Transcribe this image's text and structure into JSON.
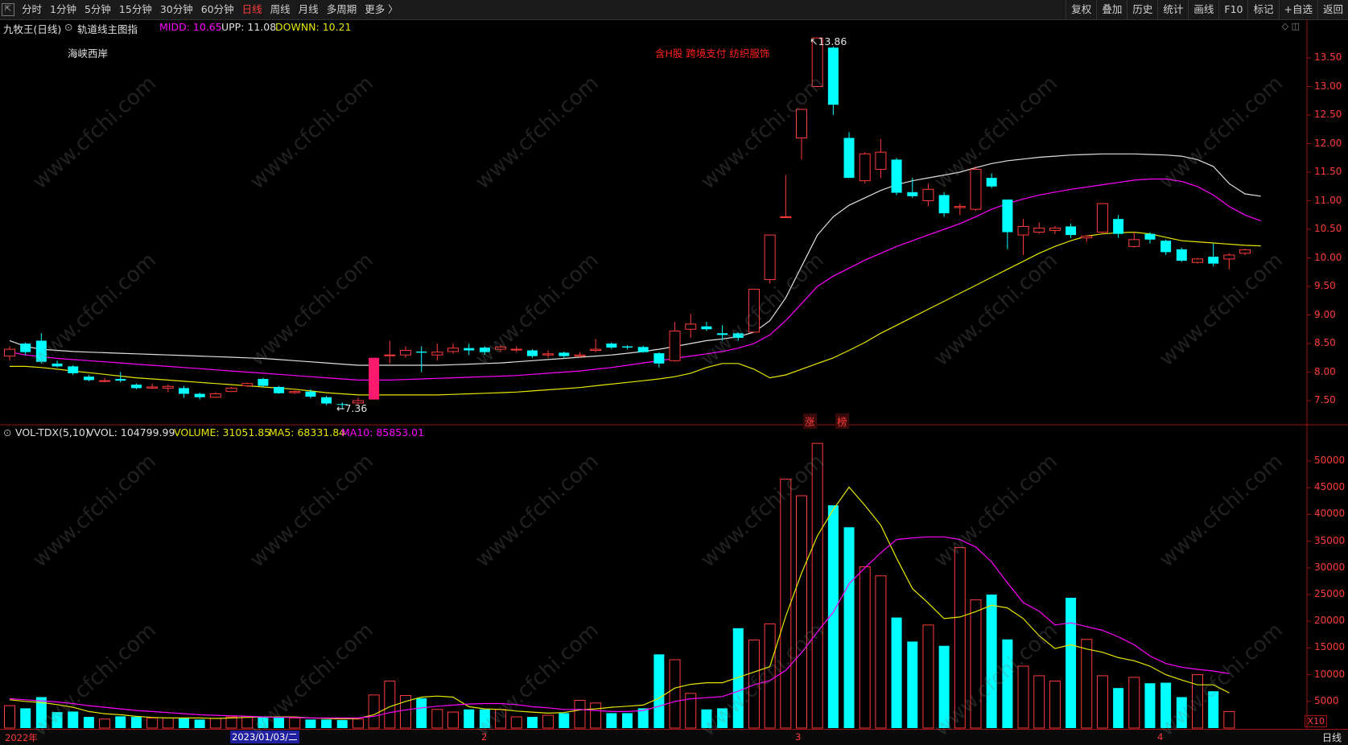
{
  "toolbar": {
    "periods": [
      "分时",
      "1分钟",
      "5分钟",
      "15分钟",
      "30分钟",
      "60分钟",
      "日线",
      "周线",
      "月线",
      "多周期",
      "更多 〉"
    ],
    "active_period": "日线",
    "right_buttons": [
      "复权",
      "叠加",
      "历史",
      "统计",
      "画线",
      "F10",
      "标记",
      "+自选",
      "返回"
    ]
  },
  "main_panel": {
    "stock_title": "九牧王(日线)",
    "indicator_name": "轨道线主图指",
    "midd_label": "MIDD: 10.65",
    "upp_label": "UPP: 11.08",
    "downn_label": "DOWNN: 10.21",
    "region_tag": "海峡西岸",
    "concept_tags": "含H股 跨境支付   纺织服饰",
    "high_marker": "13.86",
    "low_marker": "7.36",
    "event_tag_1": "涨",
    "event_tag_2": "榜",
    "y_axis": [
      "13.50",
      "13.00",
      "12.50",
      "12.00",
      "11.50",
      "11.00",
      "10.50",
      "10.00",
      "9.50",
      "9.00",
      "8.50",
      "8.00",
      "7.50"
    ]
  },
  "volume_panel": {
    "indicator_name": "VOL-TDX(5,10)",
    "vvol_label": "VVOL: 104799.99",
    "volume_label": "VOLUME: 31051.85",
    "ma5_label": "MA5: 68331.84",
    "ma10_label": "MA10: 85853.01",
    "y_axis": [
      "50000",
      "45000",
      "40000",
      "35000",
      "30000",
      "25000",
      "20000",
      "15000",
      "10000",
      "5000"
    ],
    "unit_tag": "X10"
  },
  "bottom_bar": {
    "dates": [
      "2022年",
      "2023/01/03/二",
      "2",
      "3",
      "4"
    ],
    "period_label": "日线"
  },
  "watermark_text": "www.cfchi.com",
  "colors": {
    "up": "#ff3b3b",
    "down": "#00ffff",
    "limit_up": "#ff1a6e",
    "upper_band": "#e0e0e0",
    "mid_band": "#ff00ff",
    "lower_band": "#e6e600",
    "axis": "#a01010"
  },
  "chart_data": {
    "type": "candlestick",
    "candles": [
      {
        "o": 8.28,
        "c": 8.4,
        "h": 8.45,
        "l": 8.2
      },
      {
        "o": 8.5,
        "c": 8.35,
        "h": 8.52,
        "l": 8.3
      },
      {
        "o": 8.55,
        "c": 8.18,
        "h": 8.68,
        "l": 8.15
      },
      {
        "o": 8.15,
        "c": 8.1,
        "h": 8.2,
        "l": 8.08
      },
      {
        "o": 8.1,
        "c": 7.98,
        "h": 8.12,
        "l": 7.95
      },
      {
        "o": 7.92,
        "c": 7.86,
        "h": 7.95,
        "l": 7.84
      },
      {
        "o": 7.85,
        "c": 7.85,
        "h": 7.9,
        "l": 7.82
      },
      {
        "o": 7.88,
        "c": 7.85,
        "h": 8.0,
        "l": 7.82
      },
      {
        "o": 7.78,
        "c": 7.72,
        "h": 7.8,
        "l": 7.7
      },
      {
        "o": 7.72,
        "c": 7.74,
        "h": 7.8,
        "l": 7.7
      },
      {
        "o": 7.72,
        "c": 7.75,
        "h": 7.78,
        "l": 7.65
      },
      {
        "o": 7.72,
        "c": 7.62,
        "h": 7.76,
        "l": 7.55
      },
      {
        "o": 7.62,
        "c": 7.56,
        "h": 7.64,
        "l": 7.52
      },
      {
        "o": 7.56,
        "c": 7.62,
        "h": 7.65,
        "l": 7.55
      },
      {
        "o": 7.66,
        "c": 7.72,
        "h": 7.74,
        "l": 7.65
      },
      {
        "o": 7.76,
        "c": 7.8,
        "h": 7.82,
        "l": 7.74
      },
      {
        "o": 7.88,
        "c": 7.76,
        "h": 7.9,
        "l": 7.74
      },
      {
        "o": 7.74,
        "c": 7.63,
        "h": 7.76,
        "l": 7.62
      },
      {
        "o": 7.64,
        "c": 7.66,
        "h": 7.68,
        "l": 7.62
      },
      {
        "o": 7.66,
        "c": 7.57,
        "h": 7.7,
        "l": 7.54
      },
      {
        "o": 7.56,
        "c": 7.45,
        "h": 7.58,
        "l": 7.42
      },
      {
        "o": 7.44,
        "c": 7.43,
        "h": 7.47,
        "l": 7.36
      },
      {
        "o": 7.46,
        "c": 7.5,
        "h": 7.55,
        "l": 7.43
      },
      {
        "o": 7.52,
        "c": 8.25,
        "h": 8.25,
        "l": 7.52
      },
      {
        "o": 8.3,
        "c": 8.3,
        "h": 8.55,
        "l": 8.15
      },
      {
        "o": 8.3,
        "c": 8.38,
        "h": 8.45,
        "l": 8.25
      },
      {
        "o": 8.36,
        "c": 8.34,
        "h": 8.45,
        "l": 8.0
      },
      {
        "o": 8.3,
        "c": 8.35,
        "h": 8.5,
        "l": 8.2
      },
      {
        "o": 8.36,
        "c": 8.42,
        "h": 8.5,
        "l": 8.32
      },
      {
        "o": 8.42,
        "c": 8.38,
        "h": 8.5,
        "l": 8.3
      },
      {
        "o": 8.43,
        "c": 8.35,
        "h": 8.45,
        "l": 8.3
      },
      {
        "o": 8.4,
        "c": 8.44,
        "h": 8.47,
        "l": 8.35
      },
      {
        "o": 8.4,
        "c": 8.4,
        "h": 8.45,
        "l": 8.35
      },
      {
        "o": 8.38,
        "c": 8.28,
        "h": 8.4,
        "l": 8.25
      },
      {
        "o": 8.3,
        "c": 8.32,
        "h": 8.38,
        "l": 8.25
      },
      {
        "o": 8.34,
        "c": 8.28,
        "h": 8.36,
        "l": 8.25
      },
      {
        "o": 8.28,
        "c": 8.3,
        "h": 8.35,
        "l": 8.25
      },
      {
        "o": 8.38,
        "c": 8.4,
        "h": 8.58,
        "l": 8.35
      },
      {
        "o": 8.5,
        "c": 8.43,
        "h": 8.52,
        "l": 8.4
      },
      {
        "o": 8.45,
        "c": 8.43,
        "h": 8.47,
        "l": 8.4
      },
      {
        "o": 8.44,
        "c": 8.35,
        "h": 8.46,
        "l": 8.34
      },
      {
        "o": 8.33,
        "c": 8.15,
        "h": 8.35,
        "l": 8.08
      },
      {
        "o": 8.2,
        "c": 8.72,
        "h": 8.88,
        "l": 8.18
      },
      {
        "o": 8.75,
        "c": 8.84,
        "h": 9.02,
        "l": 8.6
      },
      {
        "o": 8.8,
        "c": 8.75,
        "h": 8.88,
        "l": 8.72
      },
      {
        "o": 8.68,
        "c": 8.65,
        "h": 8.82,
        "l": 8.55
      },
      {
        "o": 8.68,
        "c": 8.6,
        "h": 8.7,
        "l": 8.55
      },
      {
        "o": 8.7,
        "c": 9.45,
        "h": 9.45,
        "l": 8.7
      },
      {
        "o": 9.62,
        "c": 10.4,
        "h": 10.4,
        "l": 9.55
      },
      {
        "o": 10.72,
        "c": 10.72,
        "h": 11.45,
        "l": 10.72
      },
      {
        "o": 12.1,
        "c": 12.6,
        "h": 12.6,
        "l": 11.72
      },
      {
        "o": 13.0,
        "c": 13.85,
        "h": 13.86,
        "l": 13.0
      },
      {
        "o": 13.68,
        "c": 12.68,
        "h": 13.7,
        "l": 12.5
      },
      {
        "o": 12.1,
        "c": 11.4,
        "h": 12.2,
        "l": 11.4
      },
      {
        "o": 11.35,
        "c": 11.82,
        "h": 11.85,
        "l": 11.3
      },
      {
        "o": 11.55,
        "c": 11.85,
        "h": 12.08,
        "l": 11.4
      },
      {
        "o": 11.72,
        "c": 11.14,
        "h": 11.75,
        "l": 11.1
      },
      {
        "o": 11.15,
        "c": 11.08,
        "h": 11.4,
        "l": 11.05
      },
      {
        "o": 11.0,
        "c": 11.2,
        "h": 11.3,
        "l": 10.9
      },
      {
        "o": 11.1,
        "c": 10.78,
        "h": 11.15,
        "l": 10.72
      },
      {
        "o": 10.88,
        "c": 10.9,
        "h": 10.95,
        "l": 10.75
      },
      {
        "o": 10.85,
        "c": 11.55,
        "h": 11.6,
        "l": 10.82
      },
      {
        "o": 11.4,
        "c": 11.25,
        "h": 11.48,
        "l": 11.22
      },
      {
        "o": 11.02,
        "c": 10.45,
        "h": 11.02,
        "l": 10.15
      },
      {
        "o": 10.4,
        "c": 10.55,
        "h": 10.68,
        "l": 10.05
      },
      {
        "o": 10.45,
        "c": 10.52,
        "h": 10.62,
        "l": 10.42
      },
      {
        "o": 10.48,
        "c": 10.52,
        "h": 10.56,
        "l": 10.42
      },
      {
        "o": 10.55,
        "c": 10.4,
        "h": 10.6,
        "l": 10.35
      },
      {
        "o": 10.35,
        "c": 10.38,
        "h": 10.4,
        "l": 10.28
      },
      {
        "o": 10.45,
        "c": 10.95,
        "h": 10.95,
        "l": 10.42
      },
      {
        "o": 10.68,
        "c": 10.42,
        "h": 10.75,
        "l": 10.35
      },
      {
        "o": 10.2,
        "c": 10.32,
        "h": 10.45,
        "l": 10.18
      },
      {
        "o": 10.42,
        "c": 10.32,
        "h": 10.45,
        "l": 10.25
      },
      {
        "o": 10.3,
        "c": 10.1,
        "h": 10.32,
        "l": 10.05
      },
      {
        "o": 10.15,
        "c": 9.95,
        "h": 10.18,
        "l": 9.93
      },
      {
        "o": 9.92,
        "c": 9.98,
        "h": 10.0,
        "l": 9.9
      },
      {
        "o": 10.02,
        "c": 9.9,
        "h": 10.25,
        "l": 9.85
      },
      {
        "o": 9.98,
        "c": 10.05,
        "h": 10.08,
        "l": 9.8
      },
      {
        "o": 10.08,
        "c": 10.14,
        "h": 10.16,
        "l": 10.05
      }
    ],
    "upper_band": [
      8.55,
      8.45,
      8.4,
      8.38,
      8.36,
      8.35,
      8.34,
      8.33,
      8.32,
      8.31,
      8.3,
      8.29,
      8.28,
      8.27,
      8.26,
      8.25,
      8.24,
      8.22,
      8.2,
      8.18,
      8.16,
      8.14,
      8.12,
      8.12,
      8.12,
      8.12,
      8.12,
      8.12,
      8.13,
      8.14,
      8.15,
      8.16,
      8.18,
      8.2,
      8.22,
      8.24,
      8.26,
      8.28,
      8.3,
      8.33,
      8.36,
      8.4,
      8.45,
      8.5,
      8.55,
      8.58,
      8.62,
      8.7,
      8.9,
      9.3,
      9.85,
      10.4,
      10.72,
      10.92,
      11.05,
      11.18,
      11.28,
      11.35,
      11.4,
      11.45,
      11.5,
      11.58,
      11.65,
      11.7,
      11.73,
      11.76,
      11.78,
      11.8,
      11.81,
      11.82,
      11.82,
      11.82,
      11.81,
      11.8,
      11.78,
      11.72,
      11.6,
      11.3,
      11.12,
      11.08
    ],
    "mid_band": [
      8.35,
      8.3,
      8.27,
      8.24,
      8.22,
      8.2,
      8.18,
      8.16,
      8.14,
      8.12,
      8.1,
      8.08,
      8.06,
      8.04,
      8.02,
      8.0,
      7.98,
      7.96,
      7.94,
      7.92,
      7.9,
      7.88,
      7.86,
      7.86,
      7.86,
      7.87,
      7.88,
      7.89,
      7.9,
      7.91,
      7.92,
      7.93,
      7.94,
      7.96,
      7.98,
      8.0,
      8.02,
      8.05,
      8.08,
      8.12,
      8.16,
      8.2,
      8.24,
      8.28,
      8.32,
      8.36,
      8.42,
      8.5,
      8.65,
      8.9,
      9.2,
      9.5,
      9.68,
      9.82,
      9.96,
      10.08,
      10.2,
      10.3,
      10.4,
      10.5,
      10.6,
      10.72,
      10.85,
      10.95,
      11.03,
      11.1,
      11.15,
      11.2,
      11.24,
      11.28,
      11.32,
      11.36,
      11.38,
      11.38,
      11.34,
      11.25,
      11.1,
      10.9,
      10.75,
      10.65
    ],
    "lower_band": [
      8.1,
      8.1,
      8.08,
      8.05,
      8.02,
      7.99,
      7.96,
      7.93,
      7.9,
      7.88,
      7.86,
      7.84,
      7.82,
      7.8,
      7.78,
      7.76,
      7.74,
      7.72,
      7.7,
      7.67,
      7.64,
      7.62,
      7.6,
      7.6,
      7.6,
      7.6,
      7.6,
      7.6,
      7.61,
      7.62,
      7.63,
      7.64,
      7.65,
      7.67,
      7.69,
      7.71,
      7.73,
      7.76,
      7.79,
      7.82,
      7.85,
      7.88,
      7.92,
      7.98,
      8.08,
      8.15,
      8.15,
      8.05,
      7.9,
      7.95,
      8.05,
      8.15,
      8.25,
      8.38,
      8.52,
      8.68,
      8.82,
      8.96,
      9.1,
      9.24,
      9.38,
      9.52,
      9.66,
      9.8,
      9.94,
      10.08,
      10.2,
      10.3,
      10.38,
      10.42,
      10.44,
      10.45,
      10.42,
      10.36,
      10.3,
      10.28,
      10.26,
      10.24,
      10.22,
      10.21
    ],
    "volume": [
      4200,
      3700,
      5800,
      3000,
      3100,
      2100,
      1700,
      2200,
      2100,
      1900,
      1900,
      1800,
      1600,
      1800,
      2100,
      2200,
      2200,
      2100,
      1900,
      1600,
      1600,
      1500,
      1700,
      6200,
      8800,
      6100,
      5600,
      3500,
      3000,
      3500,
      3500,
      3500,
      2100,
      2100,
      2400,
      2800,
      5200,
      4700,
      2800,
      2800,
      3700,
      13800,
      12800,
      6500,
      3500,
      3700,
      18700,
      16500,
      19500,
      46600,
      43500,
      53300,
      41700,
      37600,
      30200,
      28500,
      20700,
      16200,
      19300,
      15400,
      33800,
      24000,
      25000,
      16600,
      11600,
      9800,
      8800,
      24400,
      16600,
      9800,
      7500,
      9500,
      8400,
      8500,
      5800,
      10000,
      6900,
      3100
    ],
    "vol_ma5": [
      5300,
      5000,
      4800,
      4400,
      3900,
      3100,
      2700,
      2500,
      2200,
      2000,
      1900,
      1900,
      1900,
      1800,
      1900,
      2000,
      2100,
      2100,
      2100,
      1900,
      1800,
      1700,
      1800,
      2500,
      4000,
      5000,
      5800,
      6000,
      5800,
      4000,
      3600,
      3500,
      3200,
      3000,
      2800,
      2900,
      3400,
      3600,
      3900,
      4100,
      4300,
      5600,
      7500,
      8200,
      8500,
      8500,
      9500,
      10500,
      11500,
      20900,
      29000,
      36000,
      40900,
      45100,
      41700,
      38000,
      31800,
      26100,
      23400,
      20500,
      20800,
      21800,
      23000,
      22500,
      20500,
      17300,
      14900,
      15600,
      14800,
      14200,
      13200,
      12600,
      11600,
      10000,
      9000,
      8100,
      8100,
      6600
    ],
    "vol_ma10": [
      5500,
      5300,
      5100,
      4900,
      4600,
      4200,
      3900,
      3600,
      3300,
      3100,
      2900,
      2700,
      2500,
      2400,
      2300,
      2200,
      2100,
      2000,
      2000,
      1900,
      1900,
      1900,
      1900,
      2200,
      2900,
      3400,
      3800,
      4100,
      4300,
      4500,
      4600,
      4600,
      4400,
      4000,
      3800,
      3500,
      3500,
      3300,
      3100,
      3100,
      3300,
      4100,
      5000,
      5500,
      5700,
      5900,
      6900,
      8100,
      8900,
      10800,
      14100,
      18000,
      21700,
      27000,
      30000,
      32800,
      35300,
      35600,
      35800,
      35800,
      35300,
      33900,
      31100,
      27200,
      23500,
      21900,
      19300,
      19700,
      19000,
      18300,
      17100,
      15600,
      13500,
      12100,
      11400,
      11000,
      10700,
      10200
    ]
  }
}
